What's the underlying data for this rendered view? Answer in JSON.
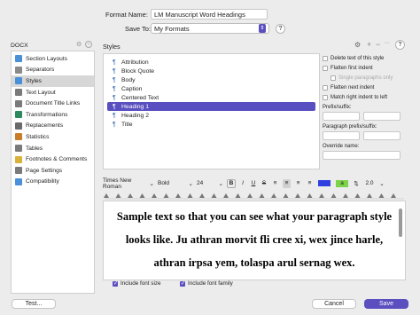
{
  "header": {
    "format_name_label": "Format Name:",
    "format_name_value": "LM Manuscript Word Headings",
    "save_to_label": "Save To:",
    "save_to_value": "My Formats",
    "help_label": "?"
  },
  "sidebar": {
    "format_select": "DOCX",
    "items": [
      {
        "label": "Section Layouts",
        "icon": "section-layouts-icon",
        "color": "#4a90d9"
      },
      {
        "label": "Separators",
        "icon": "separators-icon",
        "color": "#8a8a8a"
      },
      {
        "label": "Styles",
        "icon": "styles-icon",
        "color": "#4a90d9"
      },
      {
        "label": "Text Layout",
        "icon": "text-layout-icon",
        "color": "#7a7a7a"
      },
      {
        "label": "Document Title Links",
        "icon": "title-links-icon",
        "color": "#7a7a7a"
      },
      {
        "label": "Transformations",
        "icon": "transformations-icon",
        "color": "#2d8a5f"
      },
      {
        "label": "Replacements",
        "icon": "replacements-icon",
        "color": "#6a6a6a"
      },
      {
        "label": "Statistics",
        "icon": "statistics-icon",
        "color": "#c87d2a"
      },
      {
        "label": "Tables",
        "icon": "tables-icon",
        "color": "#7a7a7a"
      },
      {
        "label": "Footnotes & Comments",
        "icon": "footnotes-icon",
        "color": "#d9b23a"
      },
      {
        "label": "Page Settings",
        "icon": "page-settings-icon",
        "color": "#7a7a7a"
      },
      {
        "label": "Compatibility",
        "icon": "compatibility-icon",
        "color": "#4a90d9"
      }
    ],
    "selected_index": 2
  },
  "styles_panel": {
    "title": "Styles",
    "items": [
      "Attribution",
      "Block Quote",
      "Body",
      "Caption",
      "Centered Text",
      "Heading 1",
      "Heading 2",
      "Title"
    ],
    "selected_index": 5,
    "options": [
      {
        "label": "Delete text of this style",
        "checked": false,
        "disabled": false
      },
      {
        "label": "Flatten first indent",
        "checked": false,
        "disabled": false
      },
      {
        "label": "Single paragraphs only",
        "checked": false,
        "disabled": true
      },
      {
        "label": "Flatten next indent",
        "checked": false,
        "disabled": false
      },
      {
        "label": "Match right indent to left",
        "checked": false,
        "disabled": false
      }
    ],
    "prefix_suffix_label": "Prefix/suffix:",
    "paragraph_prefix_suffix_label": "Paragraph prefix/suffix:",
    "override_name_label": "Override name:"
  },
  "toolbar": {
    "font": "Times New Roman",
    "weight": "Bold",
    "size": "24",
    "bold": "B",
    "italic": "I",
    "underline": "U",
    "strike": "S",
    "highlight": "a",
    "line_spacing": "2.0",
    "text_color": "#2f3fe0",
    "highlight_color": "#7ad34a"
  },
  "sample": {
    "lines": [
      "Sample text so that you can see what your paragraph style",
      "looks like. Ju athran morvit fli cree xi, wex jince harle,",
      "athran irpsa yem, tolaspa arul sernag wex."
    ],
    "include_font_size_label": "Include font size",
    "include_font_family_label": "Include font family",
    "include_font_size_checked": true,
    "include_font_family_checked": true
  },
  "footer": {
    "test_label": "Test...",
    "cancel_label": "Cancel",
    "save_label": "Save"
  },
  "accent_color": "#5b4fbf"
}
